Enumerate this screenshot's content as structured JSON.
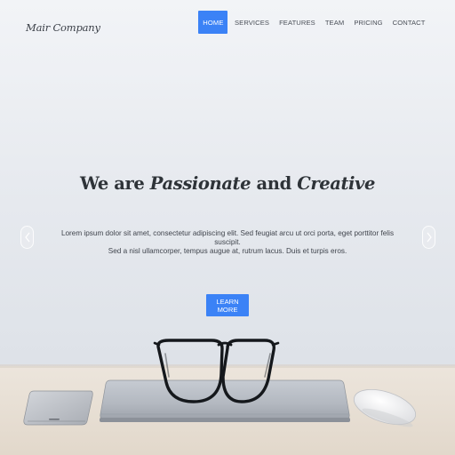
{
  "brand": {
    "name": "Mair Company"
  },
  "nav": {
    "items": [
      {
        "label": "HOME",
        "active": true
      },
      {
        "label": "SERVICES",
        "active": false
      },
      {
        "label": "FEATURES",
        "active": false
      },
      {
        "label": "TEAM",
        "active": false
      },
      {
        "label": "PRICING",
        "active": false
      },
      {
        "label": "CONTACT",
        "active": false
      }
    ]
  },
  "hero": {
    "headline": {
      "part1": "We are ",
      "part2": "Passionate",
      "part3": " and ",
      "part4": "Creative"
    },
    "body_line1": "Lorem ipsum dolor sit amet, consectetur adipiscing elit. Sed feugiat arcu ut orci porta, eget porttitor felis suscipit.",
    "body_line2": "Sed a nisl ullamcorper, tempus augue at, rutrum lacus. Duis et turpis eros.",
    "cta_label": "LEARN MORE"
  },
  "carousel": {
    "prev_icon": "chevron-left-icon",
    "next_icon": "chevron-right-icon"
  },
  "colors": {
    "accent": "#3b82f6",
    "text_dark": "#2e3338",
    "desk": "#e7ded2"
  }
}
